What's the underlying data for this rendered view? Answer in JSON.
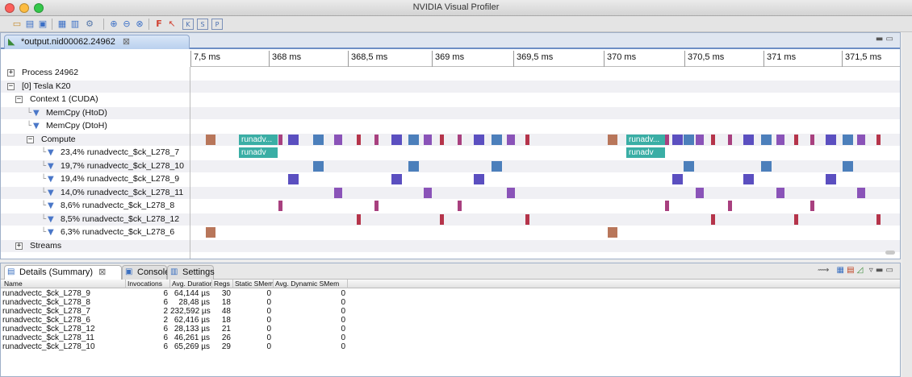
{
  "window": {
    "title": "NVIDIA Visual Profiler"
  },
  "colors": {
    "kernel_teal": "#3aaea5",
    "blue": "#4c7fbb",
    "indigo": "#5b4fc0",
    "purple": "#8a53b8",
    "magenta": "#a8407f",
    "rust": "#b8765a",
    "crimson": "#b5344a"
  },
  "toolbar": {
    "icons": [
      "new-session-icon",
      "open-icon",
      "save-icon",
      "save-all-icon",
      "timeline-icon",
      "filter-icon",
      "settings-dropdown-icon",
      "zoom-in-icon",
      "zoom-out-icon",
      "zoom-fit-icon",
      "flag-icon",
      "cursor-icon",
      "k-icon",
      "s-icon",
      "p-icon"
    ]
  },
  "editor": {
    "tab_label": "*output.nid00062.24962",
    "tab_close": "⊠",
    "ruler": [
      "7,5 ms",
      "368 ms",
      "368,5 ms",
      "369 ms",
      "369,5 ms",
      "370 ms",
      "370,5 ms",
      "371 ms",
      "371,5 ms"
    ],
    "rows": [
      {
        "label": "Process 24962",
        "exp": "+"
      },
      {
        "label": "[0] Tesla K20",
        "exp": "−"
      },
      {
        "label": "Context 1 (CUDA)",
        "exp": "−"
      },
      {
        "label": "MemCpy (HtoD)"
      },
      {
        "label": "MemCpy (DtoH)"
      },
      {
        "label": "Compute",
        "exp": "−"
      },
      {
        "label": "23,4% runadvectc_$ck_L278_7"
      },
      {
        "label": "19,7% runadvectc_$ck_L278_10"
      },
      {
        "label": "19,4% runadvectc_$ck_L278_9"
      },
      {
        "label": "14,0% runadvectc_$ck_L278_11"
      },
      {
        "label": "8,6% runadvectc_$ck_L278_8"
      },
      {
        "label": "8,5% runadvectc_$ck_L278_12"
      },
      {
        "label": "6,3% runadvectc_$ck_L278_6"
      },
      {
        "label": "Streams",
        "exp": "+"
      }
    ],
    "kernel_short": "runadv...",
    "kernel_short2": "runadv"
  },
  "bottom": {
    "tabs": [
      "Details (Summary)",
      "Console",
      "Settings"
    ],
    "tab_close": "⊠",
    "columns": [
      "Name",
      "Invocations",
      "Avg. Duration",
      "Regs",
      "Static SMem",
      "Avg. Dynamic SMem"
    ],
    "rows": [
      [
        "runadvectc_$ck_L278_9",
        "6",
        "64,144 µs",
        "30",
        "0",
        "0"
      ],
      [
        "runadvectc_$ck_L278_8",
        "6",
        "28,48 µs",
        "18",
        "0",
        "0"
      ],
      [
        "runadvectc_$ck_L278_7",
        "2",
        "232,592 µs",
        "48",
        "0",
        "0"
      ],
      [
        "runadvectc_$ck_L278_6",
        "2",
        "62,416 µs",
        "18",
        "0",
        "0"
      ],
      [
        "runadvectc_$ck_L278_12",
        "6",
        "28,133 µs",
        "21",
        "0",
        "0"
      ],
      [
        "runadvectc_$ck_L278_11",
        "6",
        "46,261 µs",
        "26",
        "0",
        "0"
      ],
      [
        "runadvectc_$ck_L278_10",
        "6",
        "65,269 µs",
        "29",
        "0",
        "0"
      ]
    ]
  }
}
